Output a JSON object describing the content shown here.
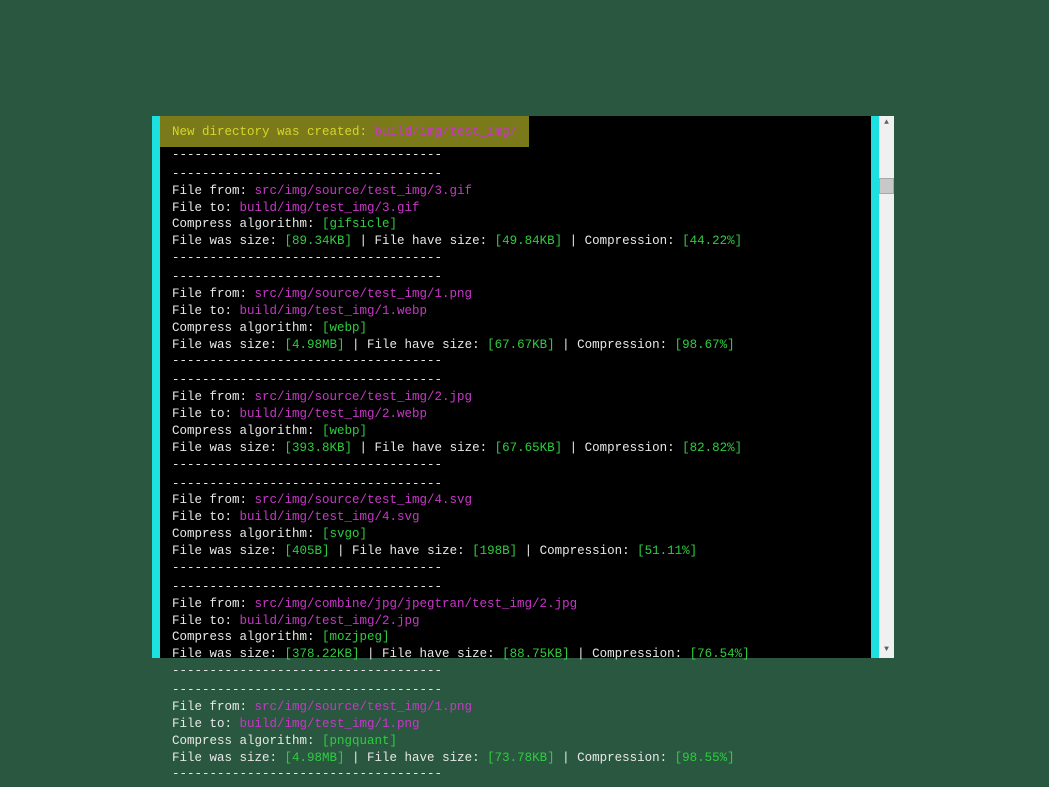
{
  "header": {
    "label": "New directory was created",
    "path": "build/img/test_img/"
  },
  "labels": {
    "file_from": "File from",
    "file_to": "File to",
    "algo": "Compress algorithm",
    "was_size": "File was size",
    "have_size": "File have size",
    "compression": "Compression",
    "separator": "------------------------------------"
  },
  "entries": [
    {
      "from": "src/img/source/test_img/3.gif",
      "to": "build/img/test_img/3.gif",
      "algo": "gifsicle",
      "was": "89.34KB",
      "have": "49.84KB",
      "comp": "44.22%"
    },
    {
      "from": "src/img/source/test_img/1.png",
      "to": "build/img/test_img/1.webp",
      "algo": "webp",
      "was": "4.98MB",
      "have": "67.67KB",
      "comp": "98.67%"
    },
    {
      "from": "src/img/source/test_img/2.jpg",
      "to": "build/img/test_img/2.webp",
      "algo": "webp",
      "was": "393.8KB",
      "have": "67.65KB",
      "comp": "82.82%"
    },
    {
      "from": "src/img/source/test_img/4.svg",
      "to": "build/img/test_img/4.svg",
      "algo": "svgo",
      "was": "405B",
      "have": "198B",
      "comp": "51.11%"
    },
    {
      "from": "src/img/combine/jpg/jpegtran/test_img/2.jpg",
      "to": "build/img/test_img/2.jpg",
      "algo": "mozjpeg",
      "was": "378.22KB",
      "have": "88.75KB",
      "comp": "76.54%"
    },
    {
      "from": "src/img/source/test_img/1.png",
      "to": "build/img/test_img/1.png",
      "algo": "pngquant",
      "was": "4.98MB",
      "have": "73.78KB",
      "comp": "98.55%"
    }
  ]
}
